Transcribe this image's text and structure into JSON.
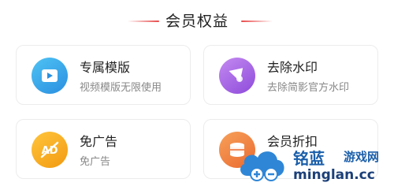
{
  "section": {
    "title": "会员权益"
  },
  "benefits": [
    {
      "name": "专属模版",
      "desc": "视频模版无限使用",
      "icon": "play-icon",
      "color": "#2fa7ea"
    },
    {
      "name": "去除水印",
      "desc": "去除简影官方水印",
      "icon": "cone-icon",
      "color": "#a55ae3"
    },
    {
      "name": "免广告",
      "desc": "免广告",
      "icon": "no-ad-icon",
      "color": "#f2a418"
    },
    {
      "name": "会员折扣",
      "desc": "",
      "icon": "coins-icon",
      "color": "#f0733a"
    }
  ],
  "watermark": {
    "name_main": "铭蓝",
    "name_sub": "游戏网",
    "url": "minglan.cc"
  }
}
